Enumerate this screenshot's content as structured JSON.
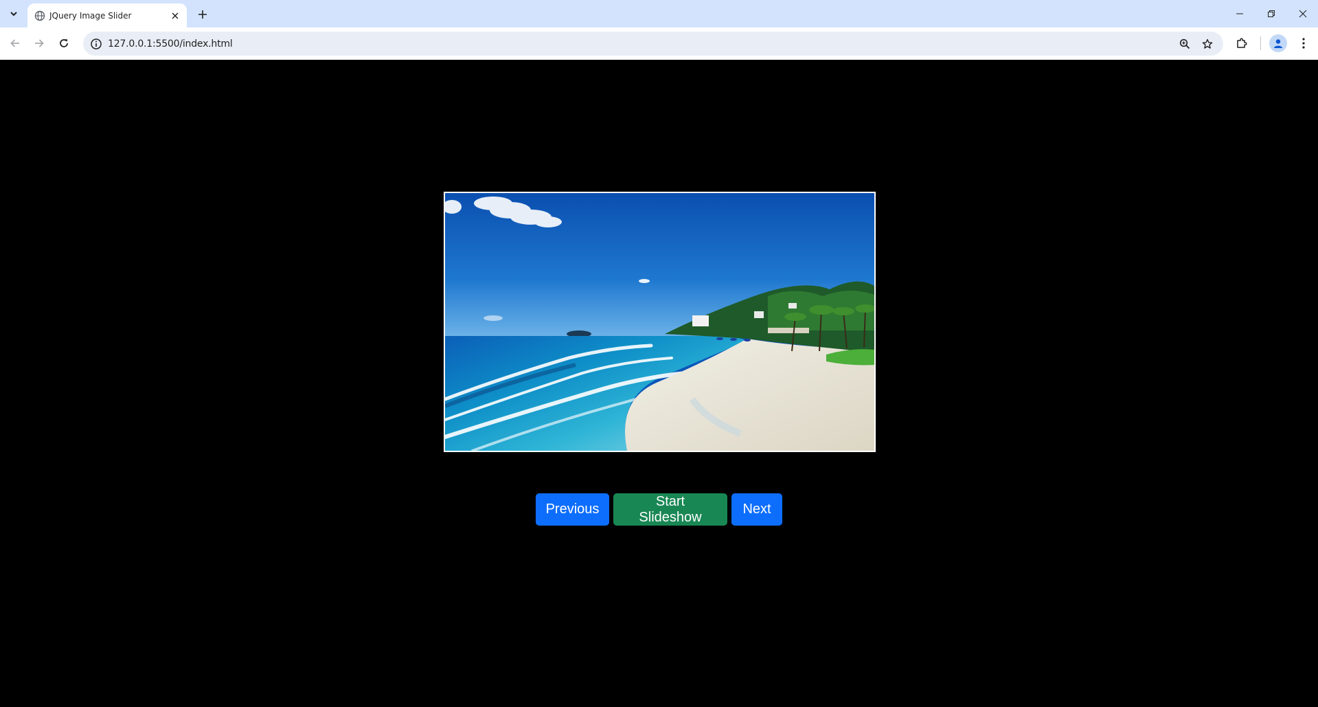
{
  "browser": {
    "tab": {
      "title": "JQuery Image Slider"
    },
    "address_bar": {
      "url": "127.0.0.1:5500/index.html"
    }
  },
  "slider": {
    "image": {
      "subject": "tropical beach with turquoise waves, white sand and palm trees"
    },
    "buttons": {
      "previous": "Previous",
      "start": "Start Slideshow",
      "next": "Next"
    },
    "colors": {
      "previous": "#0d6efd",
      "start": "#198754",
      "next": "#0d6efd"
    }
  },
  "icons": {
    "tab_list": "chevron-down-icon",
    "favicon": "globe-icon",
    "tab_close": "close-icon",
    "new_tab": "plus-icon",
    "back": "arrow-left-icon",
    "forward": "arrow-right-icon",
    "reload": "reload-icon",
    "site_info": "info-icon",
    "zoom": "zoom-icon",
    "bookmark": "star-icon",
    "extensions": "puzzle-icon",
    "profile": "person-icon",
    "menu": "kebab-menu-icon"
  }
}
